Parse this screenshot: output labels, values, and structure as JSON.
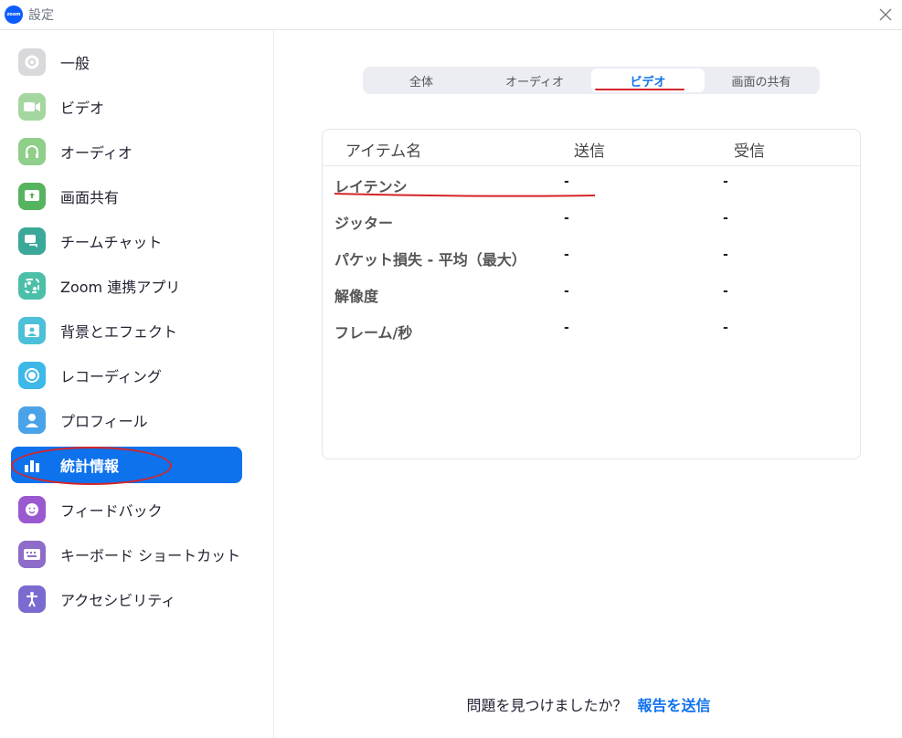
{
  "window": {
    "title": "設定",
    "logo_text": "zoom"
  },
  "sidebar": {
    "items": [
      {
        "label": "一般",
        "icon": "gear-icon",
        "color": "#d6d6d6"
      },
      {
        "label": "ビデオ",
        "icon": "video-icon",
        "color": "#7bc67b"
      },
      {
        "label": "オーディオ",
        "icon": "headphones-icon",
        "color": "#7bc67b"
      },
      {
        "label": "画面共有",
        "icon": "share-screen-icon",
        "color": "#4caf50"
      },
      {
        "label": "チームチャット",
        "icon": "chat-icon",
        "color": "#3fb39c"
      },
      {
        "label": "Zoom 連携アプリ",
        "icon": "apps-icon",
        "color": "#4cbfa8"
      },
      {
        "label": "背景とエフェクト",
        "icon": "background-icon",
        "color": "#4cc0d8"
      },
      {
        "label": "レコーディング",
        "icon": "record-icon",
        "color": "#3db8e8"
      },
      {
        "label": "プロフィール",
        "icon": "profile-icon",
        "color": "#4aa3e8"
      },
      {
        "label": "統計情報",
        "icon": "stats-icon",
        "color": "#0e72ed",
        "active": true
      },
      {
        "label": "フィードバック",
        "icon": "feedback-icon",
        "color": "#9b59d0"
      },
      {
        "label": "キーボード ショートカット",
        "icon": "keyboard-icon",
        "color": "#8e6cc9"
      },
      {
        "label": "アクセシビリティ",
        "icon": "accessibility-icon",
        "color": "#7a6bd0"
      }
    ]
  },
  "tabs": [
    {
      "label": "全体"
    },
    {
      "label": "オーディオ"
    },
    {
      "label": "ビデオ",
      "active": true
    },
    {
      "label": "画面の共有"
    }
  ],
  "stats": {
    "headers": [
      "アイテム名",
      "送信",
      "受信"
    ],
    "rows": [
      {
        "name": "レイテンシ",
        "send": "-",
        "recv": "-"
      },
      {
        "name": "ジッター",
        "send": "-",
        "recv": "-"
      },
      {
        "name": "パケット損失 - 平均（最大）",
        "send": "-",
        "recv": "-"
      },
      {
        "name": "解像度",
        "send": "-",
        "recv": "-"
      },
      {
        "name": "フレーム/秒",
        "send": "-",
        "recv": "-"
      }
    ]
  },
  "footer": {
    "question": "問題を見つけましたか？",
    "link": "報告を送信"
  },
  "colors": {
    "accent": "#0e72ed",
    "annotation": "#d3252a"
  }
}
